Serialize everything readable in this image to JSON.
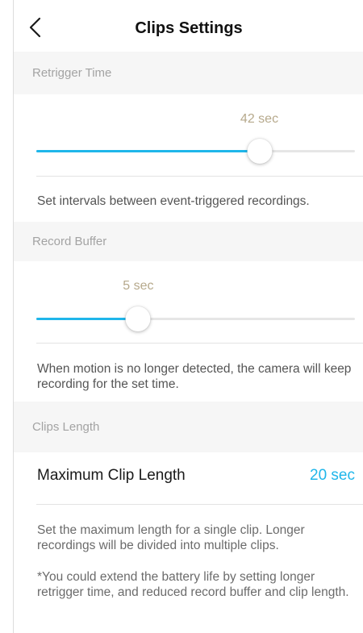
{
  "header": {
    "title": "Clips Settings",
    "back_icon": "chevron-left-icon"
  },
  "retrigger": {
    "section_title": "Retrigger Time",
    "value_label": "42 sec",
    "value_fraction": 0.7,
    "description": "Set intervals between event-triggered recordings."
  },
  "buffer": {
    "section_title": "Record Buffer",
    "value_label": "5 sec",
    "value_fraction": 0.32,
    "description": "When motion is no longer detected, the camera will keep recording for the set time."
  },
  "clips": {
    "section_title": "Clips Length",
    "max_label": "Maximum Clip Length",
    "max_value": "20 sec",
    "description": "Set the maximum length for a single clip. Longer recordings will be divided into multiple clips.",
    "note": "*You could extend the battery life by setting longer retrigger time, and reduced record buffer and clip length."
  },
  "colors": {
    "accent": "#1fb6ea",
    "value_label": "#b6a98c",
    "section_bg": "#f6f6f6"
  }
}
